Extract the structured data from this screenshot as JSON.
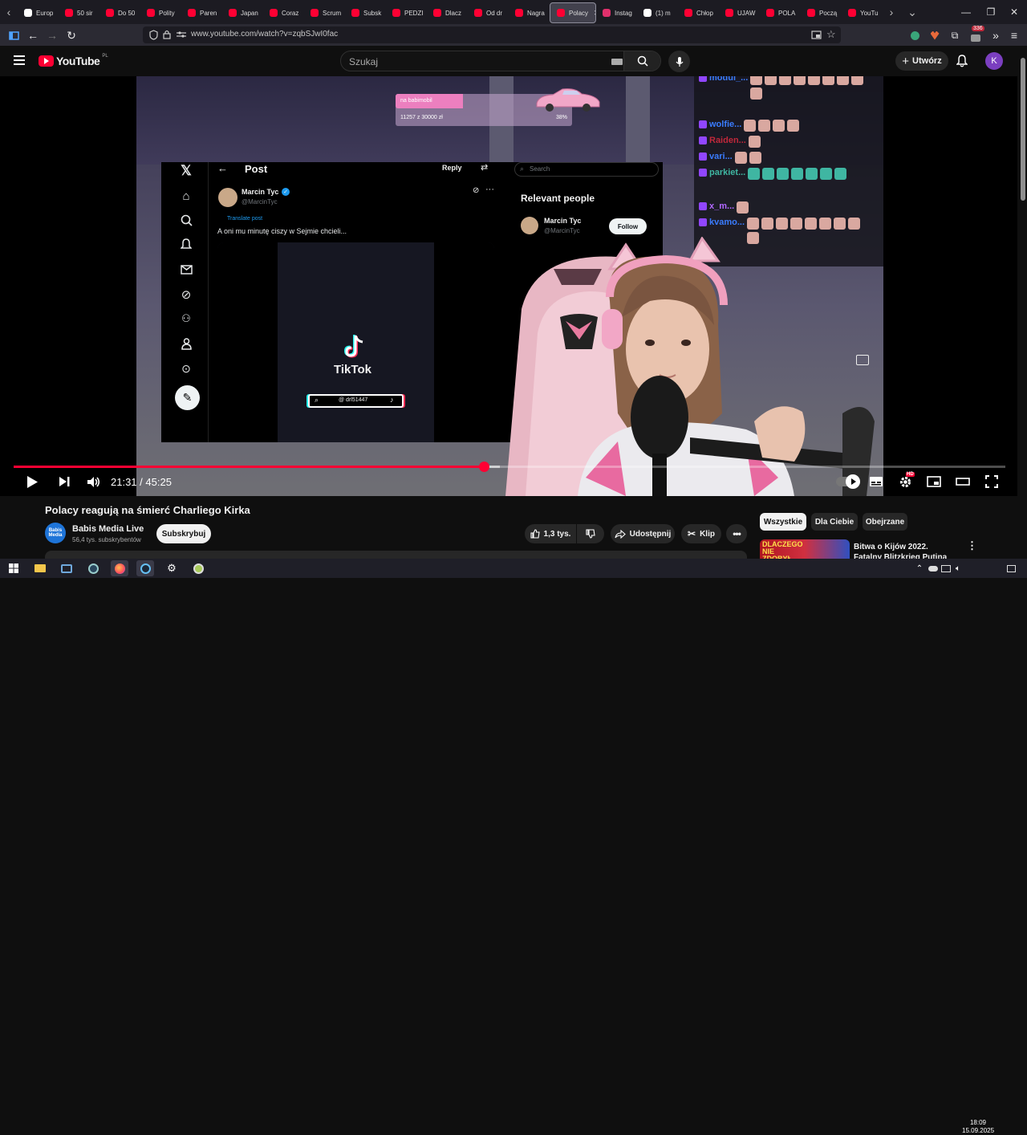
{
  "browser": {
    "tabs": [
      {
        "label": "Europ",
        "color": "#ffffff"
      },
      {
        "label": "50 sir",
        "color": "#ff0033"
      },
      {
        "label": "Do 50",
        "color": "#ff0033"
      },
      {
        "label": "Polity",
        "color": "#ff0033"
      },
      {
        "label": "Paren",
        "color": "#ff0033"
      },
      {
        "label": "Japan",
        "color": "#ff0033"
      },
      {
        "label": "Coraz",
        "color": "#ff0033"
      },
      {
        "label": "Scrum",
        "color": "#ff0033"
      },
      {
        "label": "Subsk",
        "color": "#ff0033"
      },
      {
        "label": "PEDZI",
        "color": "#ff0033"
      },
      {
        "label": "Dlacz",
        "color": "#ff0033"
      },
      {
        "label": "Od dr",
        "color": "#ff0033"
      },
      {
        "label": "Nagra",
        "color": "#ff0033"
      },
      {
        "label": "Polacy",
        "color": "#ff0033",
        "active": true
      },
      {
        "label": "Instag",
        "color": "#e1306c"
      },
      {
        "label": "(1) m",
        "color": "#ffffff"
      },
      {
        "label": "Chłop",
        "color": "#ff0033"
      },
      {
        "label": "UJAW",
        "color": "#ff0033"
      },
      {
        "label": "POLA",
        "color": "#ff0033"
      },
      {
        "label": "Począ",
        "color": "#ff0033"
      },
      {
        "label": "YouTu",
        "color": "#ff0033"
      }
    ],
    "url": "www.youtube.com/watch?v=zqbSJwI0fac",
    "extension_badge": "336"
  },
  "youtube": {
    "logo_text": "YouTube",
    "region": "PL",
    "search_placeholder": "Szukaj",
    "create_label": "Utwórz",
    "avatar_letter": "K"
  },
  "video": {
    "donation": {
      "label": "na babimobil",
      "amount": "11257 z 30000 zł",
      "percent_text": "38%",
      "progress": 0.38
    },
    "x_post": {
      "header": "Post",
      "reply_label": "Reply",
      "search_placeholder": "Search",
      "author_name": "Marcin Tyc",
      "author_handle": "@MarcinTyc",
      "translate_label": "Translate post",
      "text": "A oni mu minutę ciszy w Sejmie chcieli...",
      "relevant_title": "Relevant people",
      "relevant_name": "Marcin Tyc",
      "relevant_handle": "@MarcinTyc",
      "follow_label": "Follow",
      "tiktok_brand": "TikTok",
      "tiktok_user": "@ drl51447"
    },
    "chat": [
      {
        "name": "modul_...",
        "color": "#3a7cff",
        "emotes": 9,
        "green": false
      },
      {
        "name": "wolfie...",
        "color": "#3a7cff",
        "emotes": 4,
        "green": false
      },
      {
        "name": "Raiden...",
        "color": "#c0283a",
        "emotes": 1,
        "green": false
      },
      {
        "name": "vari...",
        "color": "#3a7cff",
        "emotes": 2,
        "green": false
      },
      {
        "name": "parkiet...",
        "color": "#3fb6a2",
        "emotes": 7,
        "green": true
      },
      {
        "name": "x_m...",
        "color": "#b068ff",
        "emotes": 1,
        "green": false
      },
      {
        "name": "kvamo...",
        "color": "#3a7cff",
        "emotes": 9,
        "green": false
      }
    ],
    "time_current": "21:31",
    "time_separator": "/",
    "time_total": "45:25",
    "played_fraction": 0.4738,
    "buffered_fraction": 0.4905,
    "hd_badge": "HD"
  },
  "watch": {
    "title": "Polacy reagują na śmierć Charliego Kirka",
    "channel_name": "Babis Media Live",
    "channel_logo_text": "Babis Media",
    "subscribers": "56,4 tys. subskrybentów",
    "subscribe_label": "Subskrybuj",
    "likes": "1,3 tys.",
    "share_label": "Udostępnij",
    "clip_label": "Klip",
    "chips": [
      "Wszystkie",
      "Dla Ciebie",
      "Obejrzane"
    ],
    "recommendation": {
      "title": "Bitwa o Kijów 2022. Fatalny Blitzkrieg Putina",
      "thumb_text": "DLACZEGO NIE ZDOBYŁ"
    }
  },
  "taskbar": {
    "time": "18:09",
    "date": "15.09.2025"
  }
}
